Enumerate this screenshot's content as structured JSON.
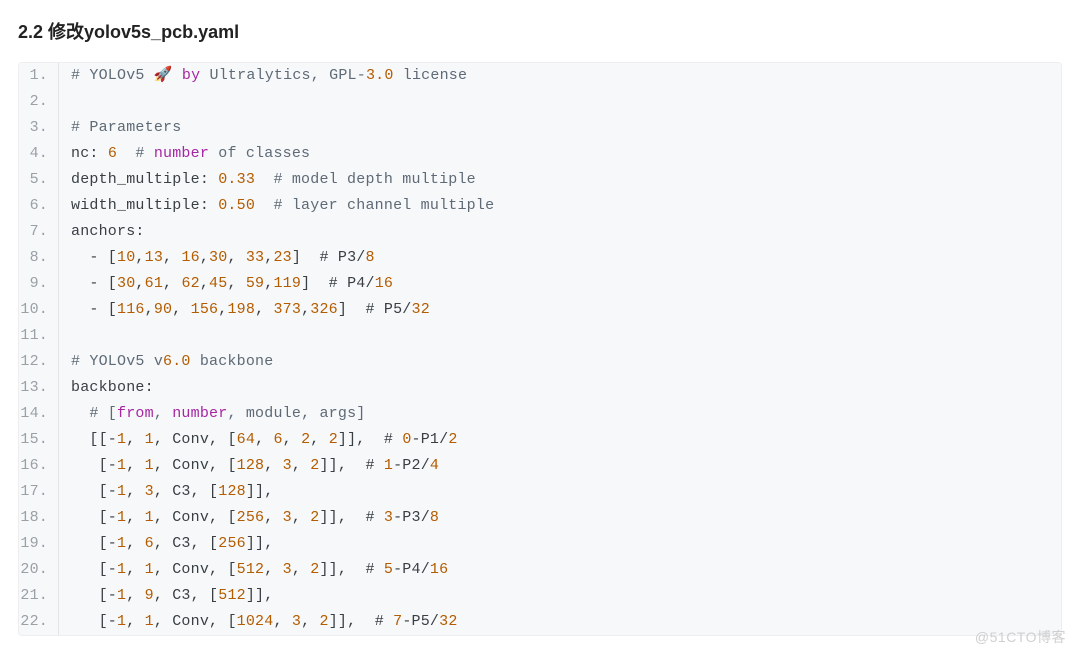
{
  "heading": "2.2 修改yolov5s_pcb.yaml",
  "watermark": "@51CTO博客",
  "code": {
    "lines": [
      {
        "n": 1,
        "tokens": [
          {
            "t": "# YOLOv5 🚀 ",
            "c": "tk-comment-hash"
          },
          {
            "t": "by",
            "c": "tk-kw"
          },
          {
            "t": " Ultralytics, GPL-",
            "c": "tk-comment-hash"
          },
          {
            "t": "3.0",
            "c": "tk-num"
          },
          {
            "t": " license",
            "c": "tk-comment-hash"
          }
        ]
      },
      {
        "n": 2,
        "tokens": [
          {
            "t": "",
            "c": ""
          }
        ]
      },
      {
        "n": 3,
        "tokens": [
          {
            "t": "# Parameters",
            "c": "tk-comment-hash"
          }
        ]
      },
      {
        "n": 4,
        "tokens": [
          {
            "t": "nc: ",
            "c": "tk-id"
          },
          {
            "t": "6",
            "c": "tk-num"
          },
          {
            "t": "  # ",
            "c": "tk-comment-hash"
          },
          {
            "t": "number",
            "c": "tk-kw"
          },
          {
            "t": " of classes",
            "c": "tk-comment-hash"
          }
        ]
      },
      {
        "n": 5,
        "tokens": [
          {
            "t": "depth_multiple: ",
            "c": "tk-id"
          },
          {
            "t": "0.33",
            "c": "tk-num"
          },
          {
            "t": "  # model depth multiple",
            "c": "tk-comment-hash"
          }
        ]
      },
      {
        "n": 6,
        "tokens": [
          {
            "t": "width_multiple: ",
            "c": "tk-id"
          },
          {
            "t": "0.50",
            "c": "tk-num"
          },
          {
            "t": "  # layer channel multiple",
            "c": "tk-comment-hash"
          }
        ]
      },
      {
        "n": 7,
        "tokens": [
          {
            "t": "anchors:",
            "c": "tk-id"
          }
        ]
      },
      {
        "n": 8,
        "tokens": [
          {
            "t": "  - [",
            "c": "tk-punct"
          },
          {
            "t": "10",
            "c": "tk-num"
          },
          {
            "t": ",",
            "c": "tk-punct"
          },
          {
            "t": "13",
            "c": "tk-num"
          },
          {
            "t": ", ",
            "c": "tk-punct"
          },
          {
            "t": "16",
            "c": "tk-num"
          },
          {
            "t": ",",
            "c": "tk-punct"
          },
          {
            "t": "30",
            "c": "tk-num"
          },
          {
            "t": ", ",
            "c": "tk-punct"
          },
          {
            "t": "33",
            "c": "tk-num"
          },
          {
            "t": ",",
            "c": "tk-punct"
          },
          {
            "t": "23",
            "c": "tk-num"
          },
          {
            "t": "]  # P3/",
            "c": "tk-punct"
          },
          {
            "t": "8",
            "c": "tk-num"
          }
        ]
      },
      {
        "n": 9,
        "tokens": [
          {
            "t": "  - [",
            "c": "tk-punct"
          },
          {
            "t": "30",
            "c": "tk-num"
          },
          {
            "t": ",",
            "c": "tk-punct"
          },
          {
            "t": "61",
            "c": "tk-num"
          },
          {
            "t": ", ",
            "c": "tk-punct"
          },
          {
            "t": "62",
            "c": "tk-num"
          },
          {
            "t": ",",
            "c": "tk-punct"
          },
          {
            "t": "45",
            "c": "tk-num"
          },
          {
            "t": ", ",
            "c": "tk-punct"
          },
          {
            "t": "59",
            "c": "tk-num"
          },
          {
            "t": ",",
            "c": "tk-punct"
          },
          {
            "t": "119",
            "c": "tk-num"
          },
          {
            "t": "]  # P4/",
            "c": "tk-punct"
          },
          {
            "t": "16",
            "c": "tk-num"
          }
        ]
      },
      {
        "n": 10,
        "tokens": [
          {
            "t": "  - [",
            "c": "tk-punct"
          },
          {
            "t": "116",
            "c": "tk-num"
          },
          {
            "t": ",",
            "c": "tk-punct"
          },
          {
            "t": "90",
            "c": "tk-num"
          },
          {
            "t": ", ",
            "c": "tk-punct"
          },
          {
            "t": "156",
            "c": "tk-num"
          },
          {
            "t": ",",
            "c": "tk-punct"
          },
          {
            "t": "198",
            "c": "tk-num"
          },
          {
            "t": ", ",
            "c": "tk-punct"
          },
          {
            "t": "373",
            "c": "tk-num"
          },
          {
            "t": ",",
            "c": "tk-punct"
          },
          {
            "t": "326",
            "c": "tk-num"
          },
          {
            "t": "]  # P5/",
            "c": "tk-punct"
          },
          {
            "t": "32",
            "c": "tk-num"
          }
        ]
      },
      {
        "n": 11,
        "tokens": [
          {
            "t": "",
            "c": ""
          }
        ]
      },
      {
        "n": 12,
        "tokens": [
          {
            "t": "# YOLOv5 v",
            "c": "tk-comment-hash"
          },
          {
            "t": "6.0",
            "c": "tk-num"
          },
          {
            "t": " backbone",
            "c": "tk-comment-hash"
          }
        ]
      },
      {
        "n": 13,
        "tokens": [
          {
            "t": "backbone:",
            "c": "tk-id"
          }
        ]
      },
      {
        "n": 14,
        "tokens": [
          {
            "t": "  # [",
            "c": "tk-comment-hash"
          },
          {
            "t": "from",
            "c": "tk-kw"
          },
          {
            "t": ", ",
            "c": "tk-comment-hash"
          },
          {
            "t": "number",
            "c": "tk-kw"
          },
          {
            "t": ", module, args]",
            "c": "tk-comment-hash"
          }
        ]
      },
      {
        "n": 15,
        "tokens": [
          {
            "t": "  [[-",
            "c": "tk-punct"
          },
          {
            "t": "1",
            "c": "tk-num"
          },
          {
            "t": ", ",
            "c": "tk-punct"
          },
          {
            "t": "1",
            "c": "tk-num"
          },
          {
            "t": ", Conv, [",
            "c": "tk-punct"
          },
          {
            "t": "64",
            "c": "tk-num"
          },
          {
            "t": ", ",
            "c": "tk-punct"
          },
          {
            "t": "6",
            "c": "tk-num"
          },
          {
            "t": ", ",
            "c": "tk-punct"
          },
          {
            "t": "2",
            "c": "tk-num"
          },
          {
            "t": ", ",
            "c": "tk-punct"
          },
          {
            "t": "2",
            "c": "tk-num"
          },
          {
            "t": "]],  # ",
            "c": "tk-punct"
          },
          {
            "t": "0",
            "c": "tk-num"
          },
          {
            "t": "-P1/",
            "c": "tk-punct"
          },
          {
            "t": "2",
            "c": "tk-num"
          }
        ]
      },
      {
        "n": 16,
        "tokens": [
          {
            "t": "   [-",
            "c": "tk-punct"
          },
          {
            "t": "1",
            "c": "tk-num"
          },
          {
            "t": ", ",
            "c": "tk-punct"
          },
          {
            "t": "1",
            "c": "tk-num"
          },
          {
            "t": ", Conv, [",
            "c": "tk-punct"
          },
          {
            "t": "128",
            "c": "tk-num"
          },
          {
            "t": ", ",
            "c": "tk-punct"
          },
          {
            "t": "3",
            "c": "tk-num"
          },
          {
            "t": ", ",
            "c": "tk-punct"
          },
          {
            "t": "2",
            "c": "tk-num"
          },
          {
            "t": "]],  # ",
            "c": "tk-punct"
          },
          {
            "t": "1",
            "c": "tk-num"
          },
          {
            "t": "-P2/",
            "c": "tk-punct"
          },
          {
            "t": "4",
            "c": "tk-num"
          }
        ]
      },
      {
        "n": 17,
        "tokens": [
          {
            "t": "   [-",
            "c": "tk-punct"
          },
          {
            "t": "1",
            "c": "tk-num"
          },
          {
            "t": ", ",
            "c": "tk-punct"
          },
          {
            "t": "3",
            "c": "tk-num"
          },
          {
            "t": ", C3, [",
            "c": "tk-punct"
          },
          {
            "t": "128",
            "c": "tk-num"
          },
          {
            "t": "]],",
            "c": "tk-punct"
          }
        ]
      },
      {
        "n": 18,
        "tokens": [
          {
            "t": "   [-",
            "c": "tk-punct"
          },
          {
            "t": "1",
            "c": "tk-num"
          },
          {
            "t": ", ",
            "c": "tk-punct"
          },
          {
            "t": "1",
            "c": "tk-num"
          },
          {
            "t": ", Conv, [",
            "c": "tk-punct"
          },
          {
            "t": "256",
            "c": "tk-num"
          },
          {
            "t": ", ",
            "c": "tk-punct"
          },
          {
            "t": "3",
            "c": "tk-num"
          },
          {
            "t": ", ",
            "c": "tk-punct"
          },
          {
            "t": "2",
            "c": "tk-num"
          },
          {
            "t": "]],  # ",
            "c": "tk-punct"
          },
          {
            "t": "3",
            "c": "tk-num"
          },
          {
            "t": "-P3/",
            "c": "tk-punct"
          },
          {
            "t": "8",
            "c": "tk-num"
          }
        ]
      },
      {
        "n": 19,
        "tokens": [
          {
            "t": "   [-",
            "c": "tk-punct"
          },
          {
            "t": "1",
            "c": "tk-num"
          },
          {
            "t": ", ",
            "c": "tk-punct"
          },
          {
            "t": "6",
            "c": "tk-num"
          },
          {
            "t": ", C3, [",
            "c": "tk-punct"
          },
          {
            "t": "256",
            "c": "tk-num"
          },
          {
            "t": "]],",
            "c": "tk-punct"
          }
        ]
      },
      {
        "n": 20,
        "tokens": [
          {
            "t": "   [-",
            "c": "tk-punct"
          },
          {
            "t": "1",
            "c": "tk-num"
          },
          {
            "t": ", ",
            "c": "tk-punct"
          },
          {
            "t": "1",
            "c": "tk-num"
          },
          {
            "t": ", Conv, [",
            "c": "tk-punct"
          },
          {
            "t": "512",
            "c": "tk-num"
          },
          {
            "t": ", ",
            "c": "tk-punct"
          },
          {
            "t": "3",
            "c": "tk-num"
          },
          {
            "t": ", ",
            "c": "tk-punct"
          },
          {
            "t": "2",
            "c": "tk-num"
          },
          {
            "t": "]],  # ",
            "c": "tk-punct"
          },
          {
            "t": "5",
            "c": "tk-num"
          },
          {
            "t": "-P4/",
            "c": "tk-punct"
          },
          {
            "t": "16",
            "c": "tk-num"
          }
        ]
      },
      {
        "n": 21,
        "tokens": [
          {
            "t": "   [-",
            "c": "tk-punct"
          },
          {
            "t": "1",
            "c": "tk-num"
          },
          {
            "t": ", ",
            "c": "tk-punct"
          },
          {
            "t": "9",
            "c": "tk-num"
          },
          {
            "t": ", C3, [",
            "c": "tk-punct"
          },
          {
            "t": "512",
            "c": "tk-num"
          },
          {
            "t": "]],",
            "c": "tk-punct"
          }
        ]
      },
      {
        "n": 22,
        "tokens": [
          {
            "t": "   [-",
            "c": "tk-punct"
          },
          {
            "t": "1",
            "c": "tk-num"
          },
          {
            "t": ", ",
            "c": "tk-punct"
          },
          {
            "t": "1",
            "c": "tk-num"
          },
          {
            "t": ", Conv, [",
            "c": "tk-punct"
          },
          {
            "t": "1024",
            "c": "tk-num"
          },
          {
            "t": ", ",
            "c": "tk-punct"
          },
          {
            "t": "3",
            "c": "tk-num"
          },
          {
            "t": ", ",
            "c": "tk-punct"
          },
          {
            "t": "2",
            "c": "tk-num"
          },
          {
            "t": "]],  # ",
            "c": "tk-punct"
          },
          {
            "t": "7",
            "c": "tk-num"
          },
          {
            "t": "-P5/",
            "c": "tk-punct"
          },
          {
            "t": "32",
            "c": "tk-num"
          }
        ]
      }
    ]
  }
}
